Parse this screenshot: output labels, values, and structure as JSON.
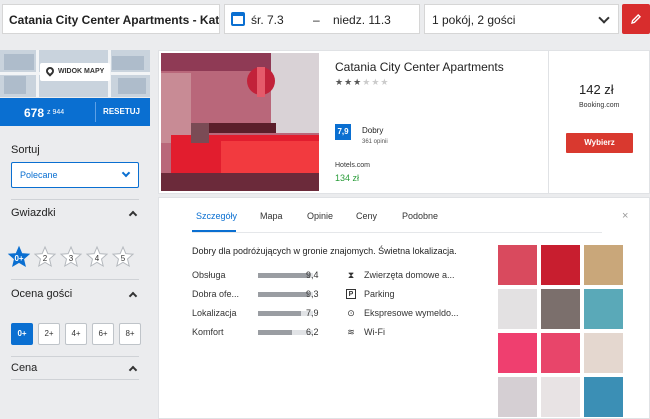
{
  "search": {
    "destination": "Catania City Center Apartments - Katan",
    "date_from": "śr. 7.3",
    "date_sep": "–",
    "date_to": "niedz. 11.3",
    "guests": "1 pokój, 2 gości"
  },
  "sidebar": {
    "map_button": "WIDOK MAPY",
    "results_count": "678",
    "results_total": "z 944",
    "reset": "RESETUJ",
    "sort_label": "Sortuj",
    "sort_value": "Polecane",
    "stars_label": "Gwiazdki",
    "stars": [
      "0+",
      "2",
      "3",
      "4",
      "5"
    ],
    "rating_label": "Ocena gości",
    "ratings": [
      "0+",
      "2+",
      "4+",
      "6+",
      "8+"
    ],
    "price_label": "Cena"
  },
  "hotel": {
    "name": "Catania City Center Apartments",
    "stars": 3,
    "stars_max": 6,
    "score": "7,9",
    "score_label": "Dobry",
    "reviews": "361 opinii",
    "provider": "Hotels.com",
    "provider_price": "134 zł",
    "price": "142 zł",
    "price_source": "Booking.com",
    "choose_label": "Wybierz"
  },
  "details": {
    "tabs": [
      "Szczegóły",
      "Mapa",
      "Opinie",
      "Ceny",
      "Podobne"
    ],
    "close": "×",
    "summary": "Dobry dla podróżujących w gronie znajomych. Świetna lokalizacja.",
    "ratings": [
      {
        "label": "Obsługa",
        "value": "9,4",
        "score": 9.4
      },
      {
        "label": "Dobra ofe...",
        "value": "9,3",
        "score": 9.3
      },
      {
        "label": "Lokalizacja",
        "value": "7,9",
        "score": 7.9
      },
      {
        "label": "Komfort",
        "value": "6,2",
        "score": 6.2
      }
    ],
    "amenities": [
      {
        "icon": "pet-icon",
        "label": "Zwierzęta domowe a..."
      },
      {
        "icon": "parking-icon",
        "label": "Parking"
      },
      {
        "icon": "express-checkout-icon",
        "label": "Ekspresowe wymeldo..."
      },
      {
        "icon": "wifi-icon",
        "label": "Wi-Fi"
      }
    ]
  },
  "colors": {
    "primary": "#0a6fd1",
    "accent_red": "#d9392f",
    "price_green": "#2a9d3a"
  }
}
